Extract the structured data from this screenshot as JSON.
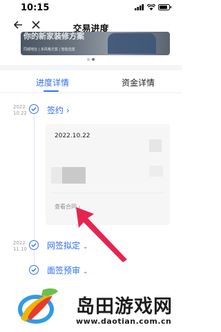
{
  "status_bar": {
    "time": "10:15"
  },
  "nav": {
    "title": "交易进度"
  },
  "banner": {
    "title": "你的新家装修方案",
    "subtitle": "同城地址 | 多风格方案 | 智能选案"
  },
  "tabs": [
    {
      "label": "进度详情",
      "active": true
    },
    {
      "label": "资金详情",
      "active": false
    }
  ],
  "timeline": [
    {
      "date_line1": "2022.",
      "date_line2": "10.22",
      "label": "签约",
      "chevron": "›"
    },
    {
      "date_line1": "2022.",
      "date_line2": "11.10",
      "label": "网签拟定",
      "chevron": "⌄"
    },
    {
      "date_line1": "",
      "date_line2": "",
      "label": "面签预审",
      "chevron": "⌄"
    }
  ],
  "contract_card": {
    "date": "2022.10.22",
    "link": "查看合同 ›"
  },
  "watermark": {
    "name": "岛田游戏网",
    "url": "www.daotian.com.cn"
  },
  "colors": {
    "accent": "#2f6df6",
    "arrow": "#e8234f"
  }
}
